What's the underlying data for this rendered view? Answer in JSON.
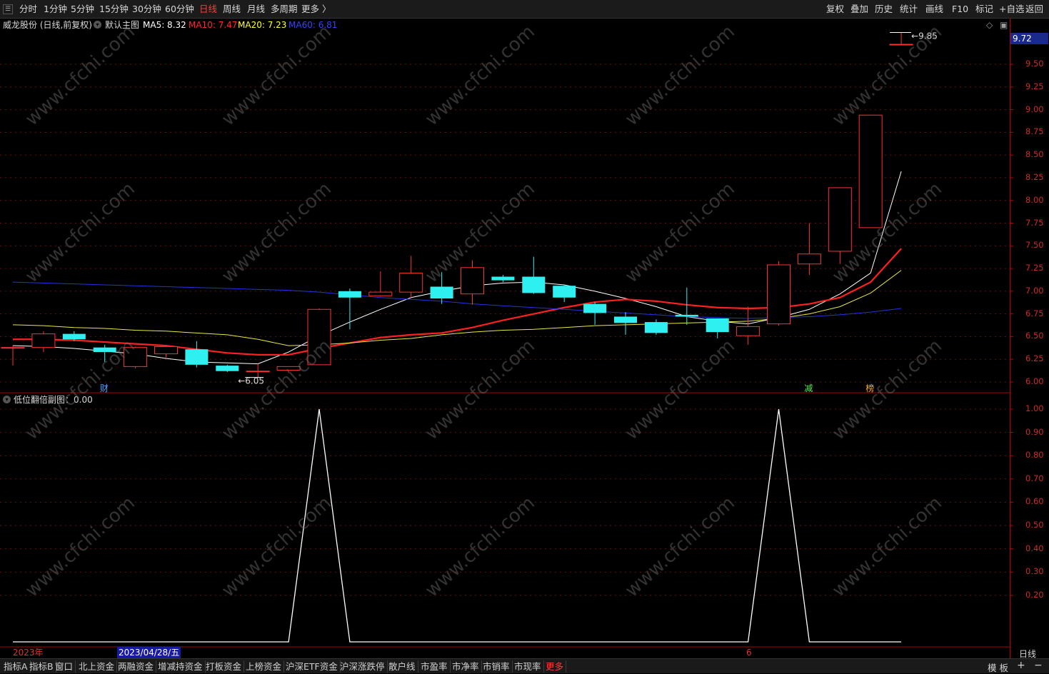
{
  "toolbar": {
    "periods": [
      "分时",
      "1分钟",
      "5分钟",
      "15分钟",
      "30分钟",
      "60分钟",
      "日线",
      "周线",
      "月线",
      "多周期",
      "更多 〉"
    ],
    "active_period": "日线",
    "actions": [
      "复权",
      "叠加",
      "历史",
      "统计",
      "画线",
      "F10",
      "标记",
      "+自选",
      "返回"
    ]
  },
  "main_chart": {
    "stock_title": "威龙股份 (日线,前复权)",
    "template": "默认主图",
    "ma_legend": [
      {
        "label": "MA5: 8.32",
        "color": "#ffffff"
      },
      {
        "label": "MA10: 7.47",
        "color": "#ff2a2a"
      },
      {
        "label": "MA20: 7.23",
        "color": "#ffff33"
      },
      {
        "label": "MA60: 6.81",
        "color": "#3344ff"
      }
    ],
    "current_price": "9.72",
    "y_ticks": [
      "9.50",
      "9.25",
      "9.00",
      "8.75",
      "8.50",
      "8.25",
      "8.00",
      "7.75",
      "7.50",
      "7.25",
      "7.00",
      "6.75",
      "6.50",
      "6.25",
      "6.00"
    ],
    "high_marker": "9.85",
    "low_marker": "6.05",
    "event_markers": [
      {
        "text": "财",
        "color": "#4da6ff"
      },
      {
        "text": "减",
        "color": "#55ee55"
      },
      {
        "text": "榜",
        "color": "#ffaa33"
      }
    ]
  },
  "sub_chart": {
    "title": "低位翻倍副图：0.00",
    "y_ticks": [
      "1.00",
      "0.90",
      "0.80",
      "0.70",
      "0.60",
      "0.50",
      "0.40",
      "0.30",
      "0.20"
    ]
  },
  "date_bar": {
    "year_label": "2023年",
    "cursor_date": "2023/04/28/五",
    "month_label": "6"
  },
  "right_footer": "日线",
  "bottom_tabs": [
    "指标A",
    "指标B",
    "窗口",
    "北上资金",
    "两融资金",
    "增减持资金",
    "打板资金",
    "上榜资金",
    "沪深ETF资金",
    "沪深涨跌停",
    "散户线",
    "市盈率",
    "市净率",
    "市销率",
    "市现率",
    "更多"
  ],
  "bottom_right": {
    "template_label": "模 板",
    "plus": "+",
    "minus": "−"
  },
  "watermark": "www.cfchi.com",
  "chart_data": [
    {
      "type": "candlestick",
      "title": "威龙股份 (日线,前复权)",
      "ylim": [
        5.94,
        9.9
      ],
      "candles": [
        {
          "o": 6.38,
          "h": 6.4,
          "l": 6.18,
          "c": 6.38
        },
        {
          "o": 6.38,
          "h": 6.56,
          "l": 6.33,
          "c": 6.53
        },
        {
          "o": 6.53,
          "h": 6.56,
          "l": 6.45,
          "c": 6.47
        },
        {
          "o": 6.38,
          "h": 6.41,
          "l": 6.22,
          "c": 6.33
        },
        {
          "o": 6.17,
          "h": 6.39,
          "l": 6.15,
          "c": 6.38
        },
        {
          "o": 6.31,
          "h": 6.4,
          "l": 6.27,
          "c": 6.39
        },
        {
          "o": 6.36,
          "h": 6.45,
          "l": 6.16,
          "c": 6.19
        },
        {
          "o": 6.18,
          "h": 6.19,
          "l": 6.11,
          "c": 6.12
        },
        {
          "o": 6.12,
          "h": 6.2,
          "l": 6.05,
          "c": 6.12
        },
        {
          "o": 6.13,
          "h": 6.15,
          "l": 6.1,
          "c": 6.17
        },
        {
          "o": 6.19,
          "h": 6.81,
          "l": 6.19,
          "c": 6.8
        },
        {
          "o": 7.0,
          "h": 7.03,
          "l": 6.58,
          "c": 6.93
        },
        {
          "o": 6.95,
          "h": 7.22,
          "l": 6.94,
          "c": 6.99
        },
        {
          "o": 6.99,
          "h": 7.39,
          "l": 6.92,
          "c": 7.2
        },
        {
          "o": 7.05,
          "h": 7.21,
          "l": 6.86,
          "c": 6.92
        },
        {
          "o": 6.97,
          "h": 7.34,
          "l": 6.85,
          "c": 7.26
        },
        {
          "o": 7.16,
          "h": 7.18,
          "l": 7.1,
          "c": 7.12
        },
        {
          "o": 7.16,
          "h": 7.38,
          "l": 6.97,
          "c": 6.98
        },
        {
          "o": 7.06,
          "h": 7.07,
          "l": 6.88,
          "c": 6.93
        },
        {
          "o": 6.86,
          "h": 6.88,
          "l": 6.63,
          "c": 6.76
        },
        {
          "o": 6.72,
          "h": 6.77,
          "l": 6.52,
          "c": 6.65
        },
        {
          "o": 6.66,
          "h": 6.69,
          "l": 6.52,
          "c": 6.54
        },
        {
          "o": 6.74,
          "h": 7.04,
          "l": 6.63,
          "c": 6.72
        },
        {
          "o": 6.7,
          "h": 6.7,
          "l": 6.48,
          "c": 6.55
        },
        {
          "o": 6.51,
          "h": 6.83,
          "l": 6.41,
          "c": 6.61
        },
        {
          "o": 6.64,
          "h": 7.33,
          "l": 6.62,
          "c": 7.29
        },
        {
          "o": 7.3,
          "h": 7.75,
          "l": 7.18,
          "c": 7.41
        },
        {
          "o": 7.44,
          "h": 8.14,
          "l": 7.3,
          "c": 8.14
        },
        {
          "o": 7.7,
          "h": 8.94,
          "l": 7.7,
          "c": 8.94
        },
        {
          "o": 9.72,
          "h": 9.85,
          "l": 9.72,
          "c": 9.72
        }
      ],
      "series": [
        {
          "name": "MA5",
          "values": [
            6.4,
            6.39,
            6.37,
            6.34,
            6.31,
            6.26,
            6.22,
            6.21,
            6.2,
            6.33,
            6.51,
            6.66,
            6.8,
            6.93,
            7.0,
            7.06,
            7.09,
            7.1,
            7.07,
            7.0,
            6.92,
            6.83,
            6.72,
            6.67,
            6.64,
            6.71,
            6.8,
            6.97,
            7.2,
            8.32
          ]
        },
        {
          "name": "MA10",
          "values": [
            6.47,
            6.47,
            6.46,
            6.44,
            6.42,
            6.4,
            6.36,
            6.32,
            6.3,
            6.3,
            6.37,
            6.43,
            6.49,
            6.52,
            6.54,
            6.6,
            6.68,
            6.75,
            6.82,
            6.88,
            6.91,
            6.89,
            6.85,
            6.82,
            6.81,
            6.82,
            6.86,
            6.93,
            7.1,
            7.47
          ]
        },
        {
          "name": "MA20",
          "values": [
            6.63,
            6.62,
            6.6,
            6.59,
            6.57,
            6.56,
            6.54,
            6.52,
            6.47,
            6.4,
            6.41,
            6.43,
            6.46,
            6.48,
            6.52,
            6.55,
            6.57,
            6.58,
            6.6,
            6.62,
            6.63,
            6.64,
            6.65,
            6.66,
            6.67,
            6.7,
            6.75,
            6.83,
            6.98,
            7.23
          ]
        },
        {
          "name": "MA60",
          "values": [
            7.1,
            7.09,
            7.08,
            7.07,
            7.06,
            7.05,
            7.04,
            7.03,
            7.02,
            7.01,
            6.99,
            6.96,
            6.93,
            6.91,
            6.89,
            6.86,
            6.84,
            6.82,
            6.8,
            6.78,
            6.76,
            6.74,
            6.72,
            6.71,
            6.7,
            6.71,
            6.72,
            6.74,
            6.77,
            6.81
          ]
        }
      ]
    },
    {
      "type": "line",
      "title": "低位翻倍副图",
      "ylim": [
        0,
        1.0
      ],
      "series": [
        {
          "name": "低位翻倍",
          "values": [
            0,
            0,
            0,
            0,
            0,
            0,
            0,
            0,
            0,
            0,
            1,
            0,
            0,
            0,
            0,
            0,
            0,
            0,
            0,
            0,
            0,
            0,
            0,
            0,
            0,
            1,
            0,
            0,
            0,
            0
          ]
        }
      ]
    }
  ]
}
